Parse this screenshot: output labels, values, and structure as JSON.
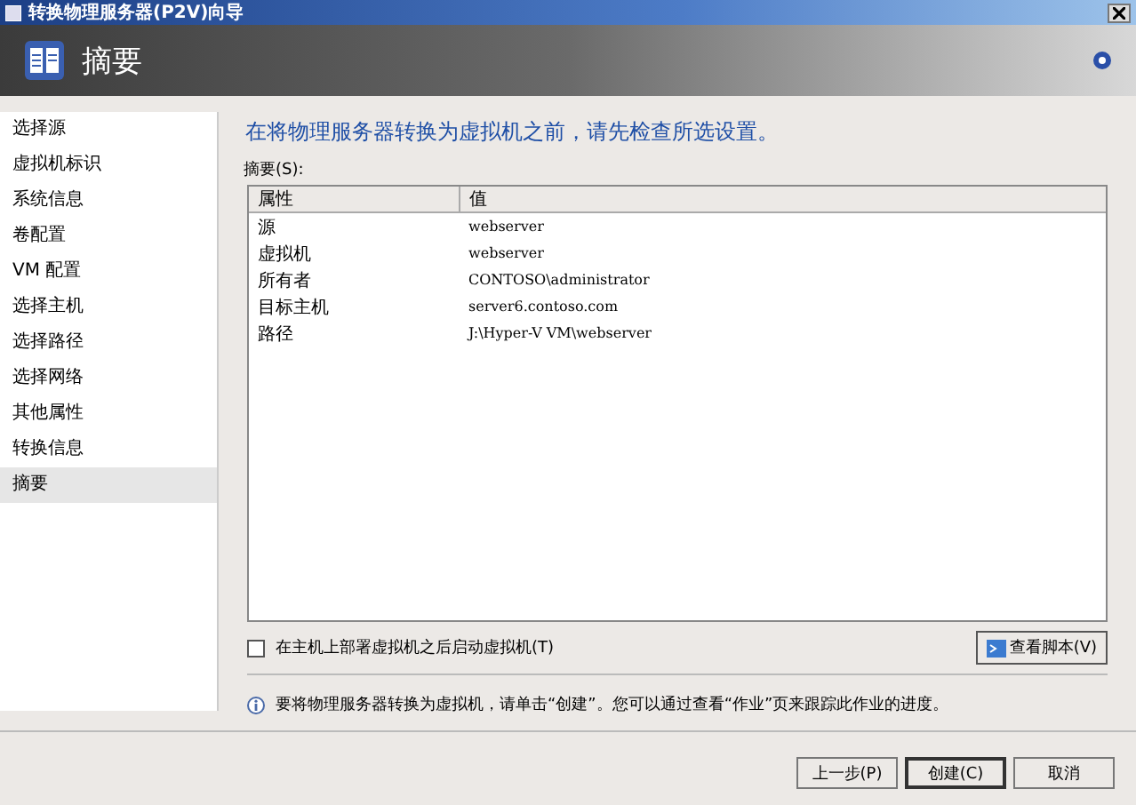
{
  "window": {
    "title": "转换物理服务器(P2V)向导"
  },
  "header": {
    "title": "摘要"
  },
  "sidebar": {
    "items": [
      {
        "label": "选择源",
        "selected": false
      },
      {
        "label": "虚拟机标识",
        "selected": false
      },
      {
        "label": "系统信息",
        "selected": false
      },
      {
        "label": "卷配置",
        "selected": false
      },
      {
        "label": "VM 配置",
        "selected": false
      },
      {
        "label": "选择主机",
        "selected": false
      },
      {
        "label": "选择路径",
        "selected": false
      },
      {
        "label": "选择网络",
        "selected": false
      },
      {
        "label": "其他属性",
        "selected": false
      },
      {
        "label": "转换信息",
        "selected": false
      },
      {
        "label": "摘要",
        "selected": true
      }
    ]
  },
  "content": {
    "heading": "在将物理服务器转换为虚拟机之前，请先检查所选设置。",
    "table_label": "摘要(S):",
    "table": {
      "columns": [
        "属性",
        "值"
      ],
      "rows": [
        [
          "源",
          "webserver"
        ],
        [
          "虚拟机",
          "webserver"
        ],
        [
          "所有者",
          "CONTOSO\\administrator"
        ],
        [
          "目标主机",
          "server6.contoso.com"
        ],
        [
          "路径",
          "J:\\Hyper-V VM\\webserver"
        ]
      ]
    },
    "start_checkbox": {
      "label": "在主机上部署虚拟机之后启动虚拟机(T)",
      "checked": false
    },
    "view_script_button": "查看脚本(V)",
    "info": "要将物理服务器转换为虚拟机，请单击“创建”。您可以通过查看“作业”页来跟踪此作业的进度。"
  },
  "buttons": [
    {
      "label": "上一步(P)",
      "default": false
    },
    {
      "label": "创建(C)",
      "default": true
    },
    {
      "label": "取消",
      "default": false
    }
  ]
}
